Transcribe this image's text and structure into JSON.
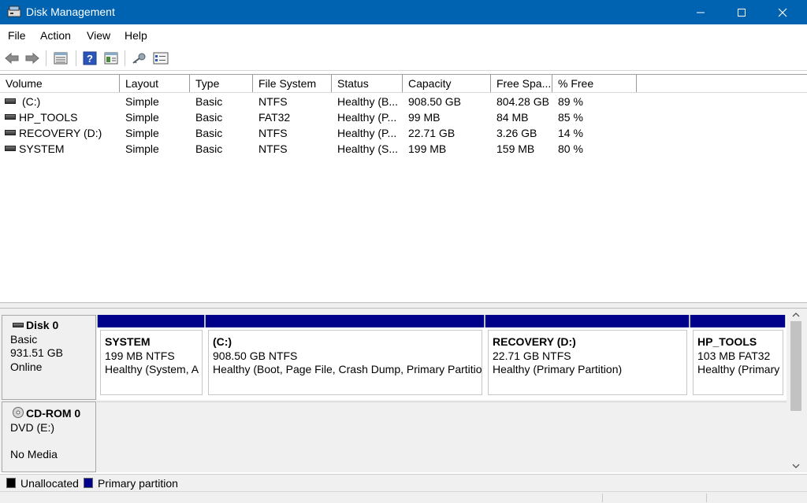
{
  "window": {
    "title": "Disk Management"
  },
  "menu": [
    "File",
    "Action",
    "View",
    "Help"
  ],
  "toolbar_icons": [
    "back-arrow-icon",
    "forward-arrow-icon",
    "disk-list-icon",
    "help-icon",
    "pane-icon",
    "key-icon",
    "properties-icon"
  ],
  "columns": [
    "Volume",
    "Layout",
    "Type",
    "File System",
    "Status",
    "Capacity",
    "Free Spa...",
    "% Free"
  ],
  "volumes": [
    {
      "volume": "(C:)",
      "layout": "Simple",
      "type": "Basic",
      "fs": "NTFS",
      "status": "Healthy (B...",
      "capacity": "908.50 GB",
      "free": "804.28 GB",
      "pct": "89 %"
    },
    {
      "volume": "HP_TOOLS",
      "layout": "Simple",
      "type": "Basic",
      "fs": "FAT32",
      "status": "Healthy (P...",
      "capacity": "99 MB",
      "free": "84 MB",
      "pct": "85 %"
    },
    {
      "volume": "RECOVERY (D:)",
      "layout": "Simple",
      "type": "Basic",
      "fs": "NTFS",
      "status": "Healthy (P...",
      "capacity": "22.71 GB",
      "free": "3.26 GB",
      "pct": "14 %"
    },
    {
      "volume": "SYSTEM",
      "layout": "Simple",
      "type": "Basic",
      "fs": "NTFS",
      "status": "Healthy (S...",
      "capacity": "199 MB",
      "free": "159 MB",
      "pct": "80 %"
    }
  ],
  "disks": [
    {
      "name": "Disk 0",
      "type": "Basic",
      "size": "931.51 GB",
      "state": "Online",
      "partitions": [
        {
          "name": "SYSTEM",
          "size": "199 MB NTFS",
          "status": "Healthy (System, A"
        },
        {
          "name": "(C:)",
          "size": "908.50 GB NTFS",
          "status": "Healthy (Boot, Page File, Crash Dump, Primary Partitio"
        },
        {
          "name": "RECOVERY  (D:)",
          "size": "22.71 GB NTFS",
          "status": "Healthy (Primary Partition)"
        },
        {
          "name": "HP_TOOLS",
          "size": "103 MB FAT32",
          "status": "Healthy (Primary"
        }
      ]
    }
  ],
  "cdrom": {
    "name": "CD-ROM 0",
    "drive": "DVD (E:)",
    "media": "No Media"
  },
  "legend": [
    {
      "label": "Unallocated",
      "color": "#000000"
    },
    {
      "label": "Primary partition",
      "color": "#00008b"
    }
  ]
}
